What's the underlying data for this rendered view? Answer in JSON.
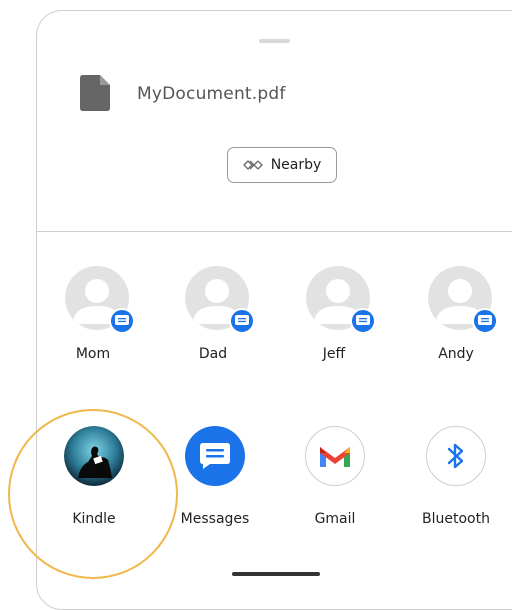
{
  "file": {
    "name": "MyDocument.pdf",
    "icon": "file-icon"
  },
  "nearby": {
    "label": "Nearby",
    "icon": "nearby-share-icon"
  },
  "contacts": [
    {
      "name": "Mom",
      "badge_icon": "messages-badge-icon"
    },
    {
      "name": "Dad",
      "badge_icon": "messages-badge-icon"
    },
    {
      "name": "Jeff",
      "badge_icon": "messages-badge-icon"
    },
    {
      "name": "Andy",
      "badge_icon": "messages-badge-icon"
    }
  ],
  "apps": [
    {
      "name": "Kindle",
      "icon": "kindle-icon"
    },
    {
      "name": "Messages",
      "icon": "messages-icon"
    },
    {
      "name": "Gmail",
      "icon": "gmail-icon"
    },
    {
      "name": "Bluetooth",
      "icon": "bluetooth-icon"
    }
  ],
  "colors": {
    "accent_blue": "#1a73e8",
    "highlight": "#f0b84c",
    "avatar_bg": "#e2e2e2",
    "divider": "#cfcfcf"
  }
}
